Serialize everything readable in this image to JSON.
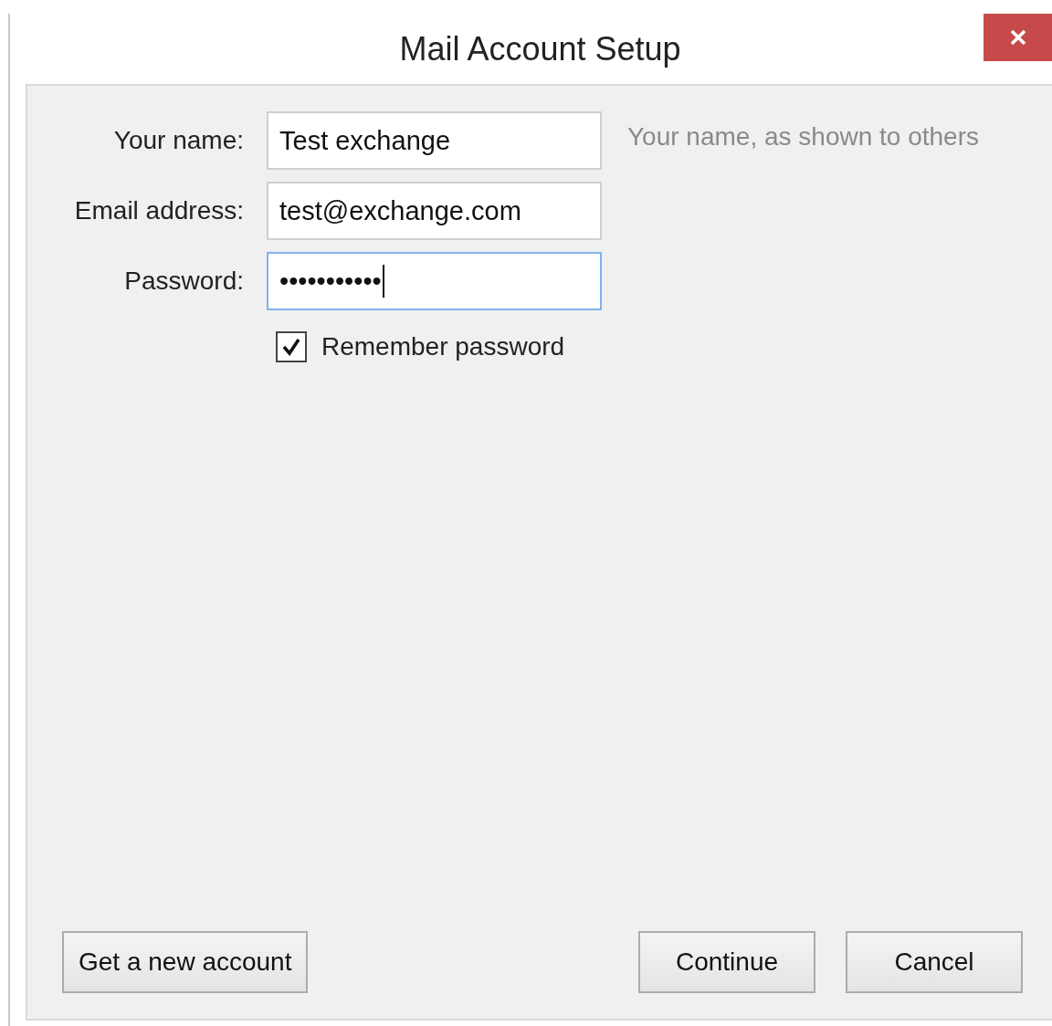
{
  "window": {
    "title": "Mail Account Setup"
  },
  "fields": [
    {
      "label": "Your name:",
      "value": "Test exchange",
      "hint": "Your name, as shown to others",
      "focused": false
    },
    {
      "label": "Email address:",
      "value": "test@exchange.com",
      "focused": false
    },
    {
      "label": "Password:",
      "value": "•••••••••••",
      "focused": true
    }
  ],
  "remember_password": {
    "label": "Remember password",
    "checked": true
  },
  "left_buttons": [
    {
      "label": "Get a new account"
    }
  ],
  "right_buttons": [
    {
      "label": "Continue"
    },
    {
      "label": "Cancel"
    }
  ]
}
